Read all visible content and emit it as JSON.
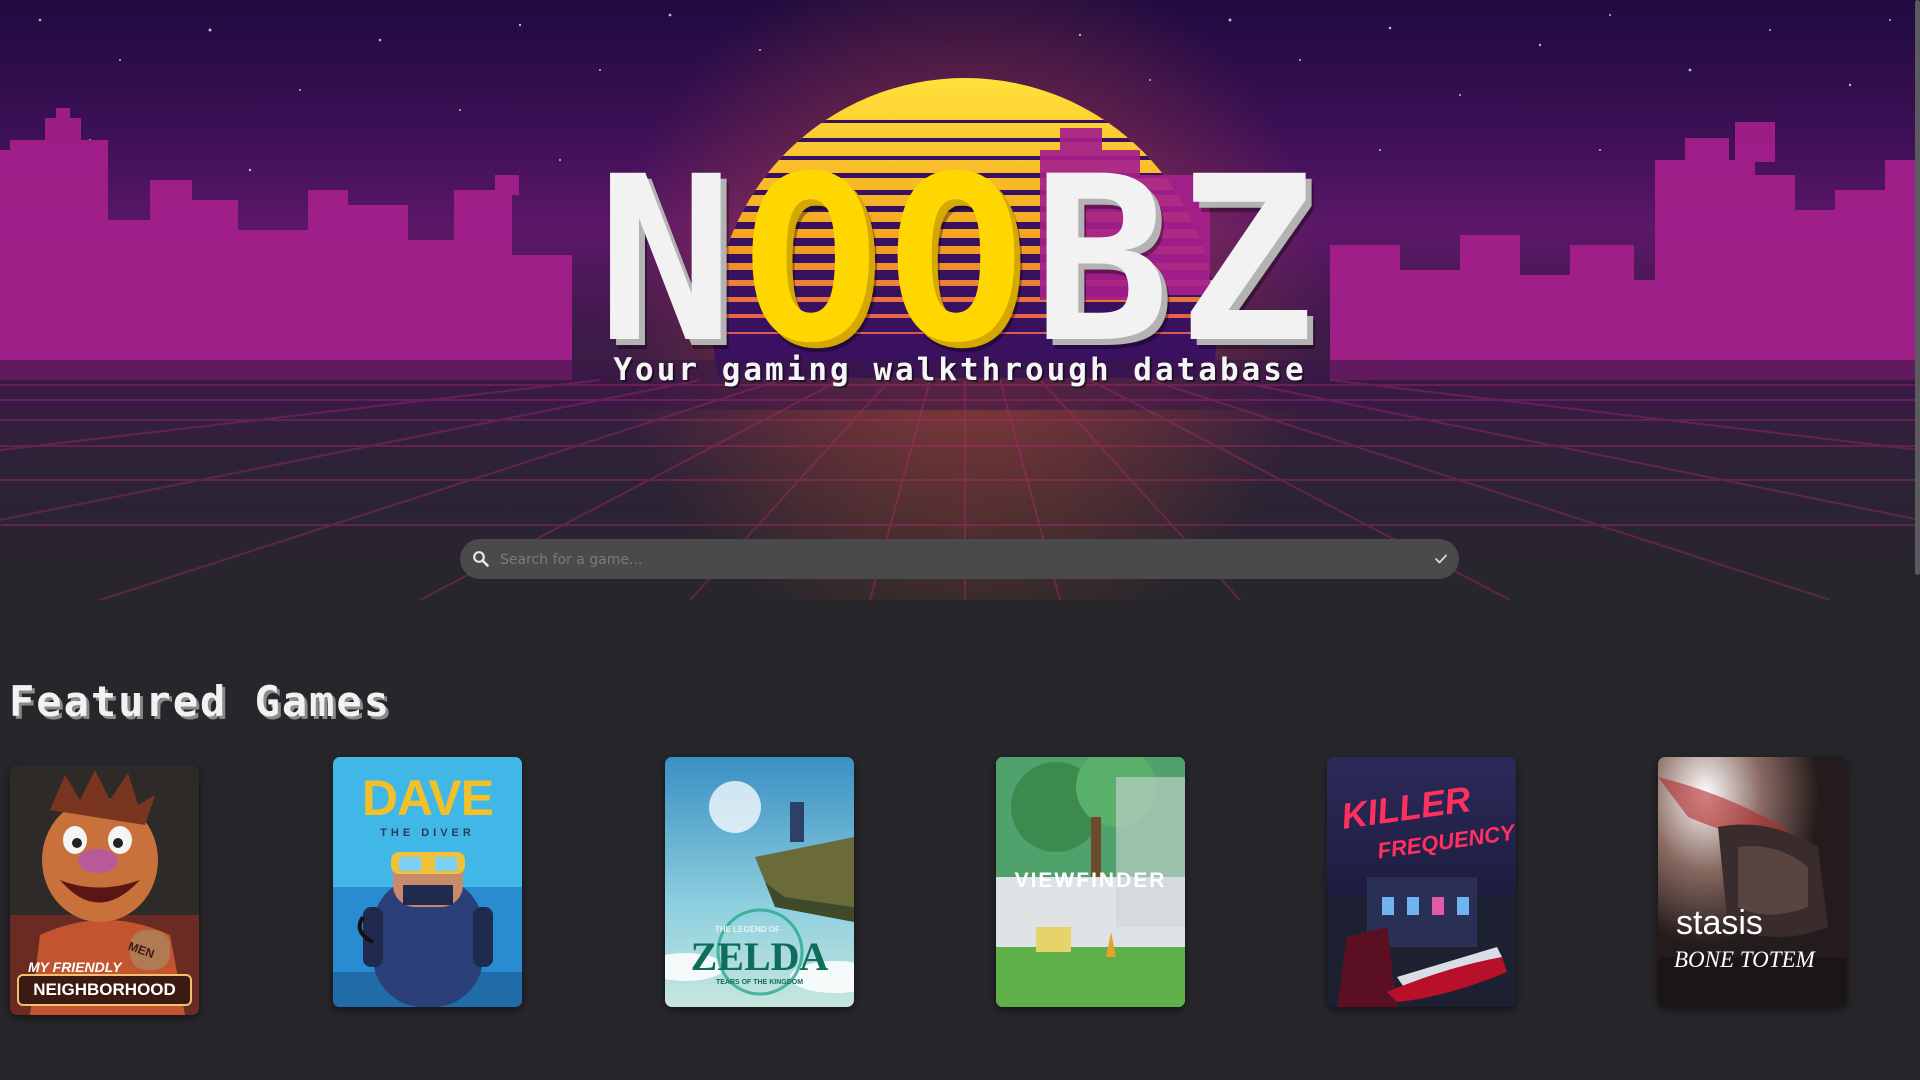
{
  "brand": {
    "logo_parts": [
      "N",
      "OO",
      "BZ"
    ],
    "tagline": "Your gaming walkthrough database"
  },
  "colors": {
    "logo_white": "#f2f2f2",
    "logo_yellow": "#fed700",
    "page_background": "#27262b",
    "sky_top": "#1f0b40",
    "skyline_magenta": "#a61f8c",
    "search_background": "#4a4a4d"
  },
  "search": {
    "placeholder": "Search for a game...",
    "value": "",
    "icon": "magnifier-icon",
    "dropdown_icon": "check-icon"
  },
  "featured": {
    "heading": "Featured Games",
    "games": [
      {
        "title_line1": "MY FRIENDLY",
        "title_line2": "NEIGHBORHOOD",
        "badge": "MEN"
      },
      {
        "title_line1": "DAVE",
        "title_line2": "THE DIVER"
      },
      {
        "title_line1": "THE LEGEND OF",
        "title_line2": "ZELDA",
        "title_line3": "TEARS OF THE KINGDOM"
      },
      {
        "title_line1": "VIEWFINDER"
      },
      {
        "title_line1": "KILLER",
        "title_line2": "FREQUENCY"
      },
      {
        "title_line1": "stasis",
        "title_line2": "BONE TOTEM"
      }
    ]
  }
}
